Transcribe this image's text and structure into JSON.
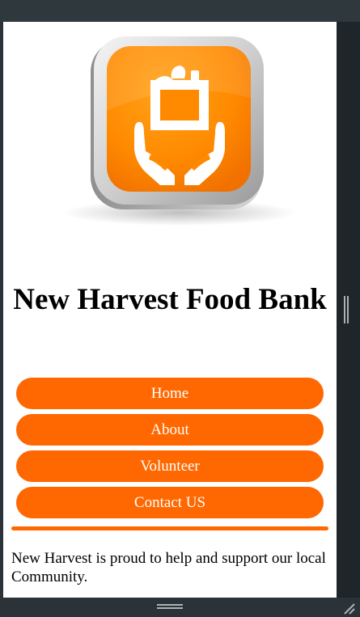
{
  "site": {
    "title": "New Harvest Food Bank",
    "logo_icon": "food-donation-app-icon",
    "accent_color": "#ff6800"
  },
  "nav": {
    "items": [
      {
        "label": "Home"
      },
      {
        "label": "About"
      },
      {
        "label": "Volunteer"
      },
      {
        "label": "Contact US"
      }
    ]
  },
  "content": {
    "intro": "New Harvest is proud to help and support our local Community."
  }
}
